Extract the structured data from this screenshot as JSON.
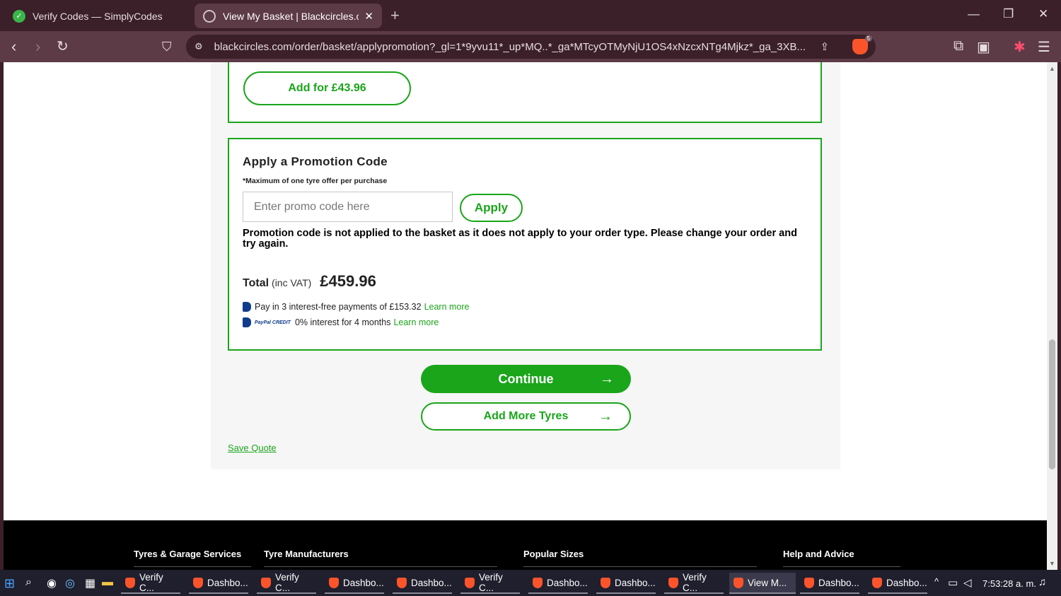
{
  "browser": {
    "tabs": [
      {
        "title": "Verify Codes — SimplyCodes",
        "active": false
      },
      {
        "title": "View My Basket | Blackcircles.com",
        "active": true
      }
    ],
    "url": "blackcircles.com/order/basket/applypromotion?_gl=1*9yvu11*_up*MQ..*_ga*MTcyOTMyNjU1OS4xNzcxNTg4Mjkz*_ga_3XB...",
    "brave_badge": "5"
  },
  "tyre_offer": {
    "add_button_label": "Add for £43.96"
  },
  "promo": {
    "heading": "Apply a Promotion Code",
    "note": "*Maximum of one tyre offer per purchase",
    "input_placeholder": "Enter promo code here",
    "input_value": "",
    "apply_label": "Apply",
    "error_message": "Promotion code is not applied to the basket as it does not apply to your order type. Please change your order and try again.",
    "total_label": "Total",
    "total_vat": "(inc VAT)",
    "total_amount": "£459.96",
    "paypal_pay_in_3": "Pay in 3 interest-free payments of £153.32",
    "paypal_credit": "0% interest for 4 months",
    "paypal_credit_logo": "PayPal CREDIT",
    "learn_more": "Learn more"
  },
  "actions": {
    "continue_label": "Continue",
    "add_more_label": "Add More Tyres",
    "save_quote_label": "Save Quote"
  },
  "footer": {
    "columns": [
      "Tyres & Garage Services",
      "Tyre Manufacturers",
      "Popular Sizes",
      "Help and Advice"
    ]
  },
  "taskbar": {
    "items": [
      {
        "label": "Verify C...",
        "active": false
      },
      {
        "label": "Dashbo...",
        "active": false
      },
      {
        "label": "Verify C...",
        "active": false
      },
      {
        "label": "Dashbo...",
        "active": false
      },
      {
        "label": "Dashbo...",
        "active": false
      },
      {
        "label": "Verify C...",
        "active": false
      },
      {
        "label": "Dashbo...",
        "active": false
      },
      {
        "label": "Dashbo...",
        "active": false
      },
      {
        "label": "Verify C...",
        "active": false
      },
      {
        "label": "View M...",
        "active": true
      },
      {
        "label": "Dashbo...",
        "active": false
      },
      {
        "label": "Dashbo...",
        "active": false
      }
    ],
    "clock": "7:53:28 a. m."
  },
  "colors": {
    "accent_green": "#1aa51a",
    "chrome_dark": "#3b1f29",
    "chrome_mid": "#5c3a46",
    "footer_bg": "#000000"
  }
}
